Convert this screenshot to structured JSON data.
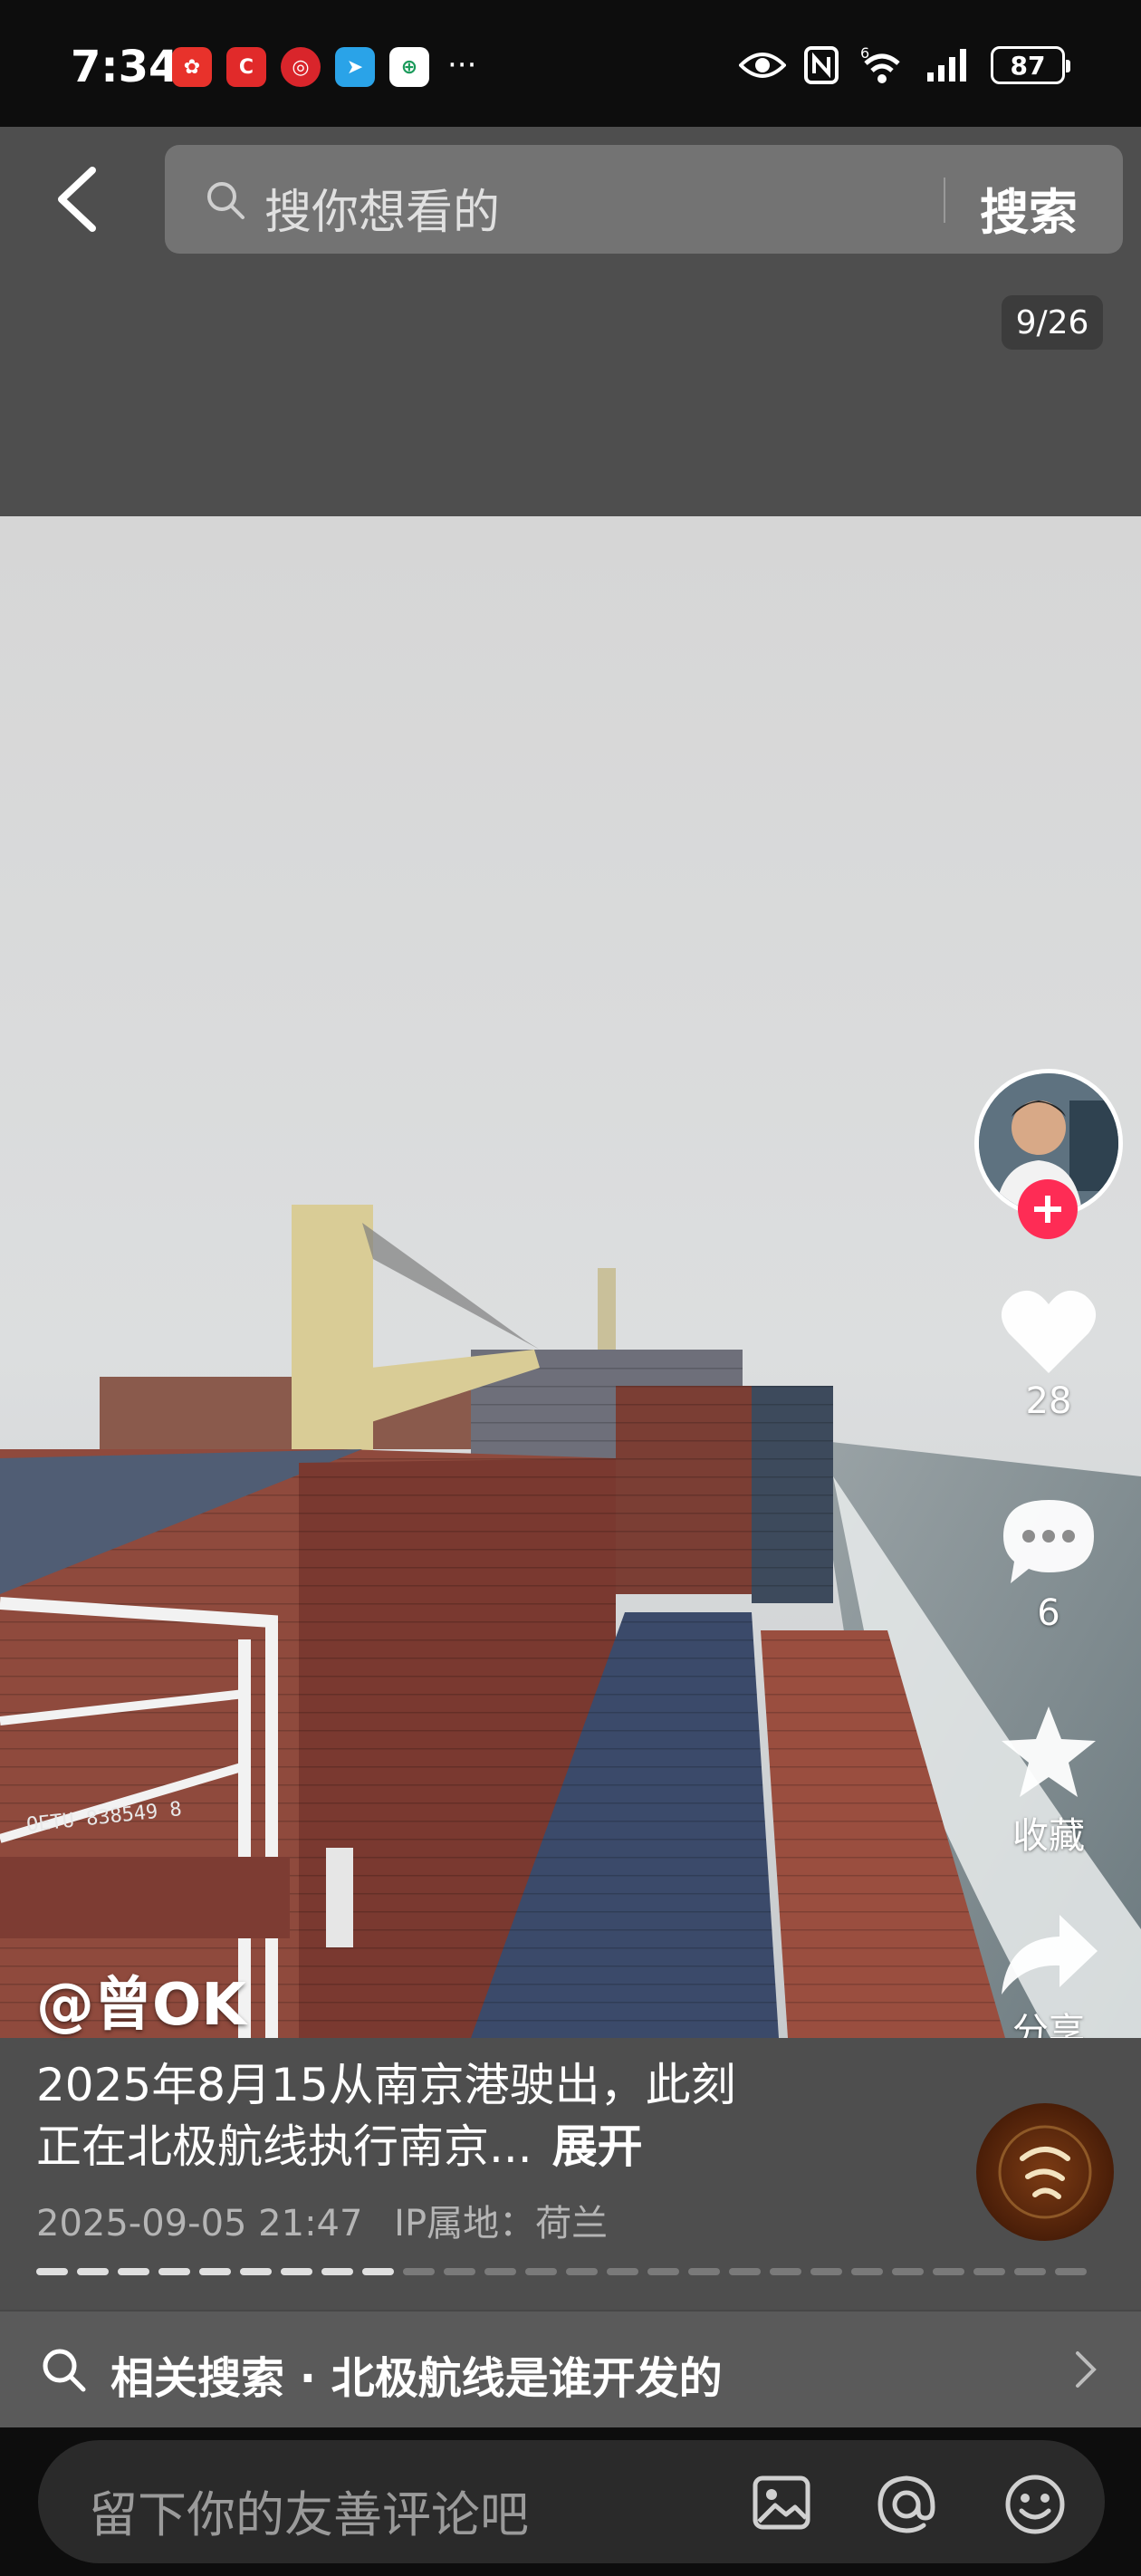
{
  "status_bar": {
    "time": "7:34",
    "battery": "87",
    "overflow": "···",
    "signal_label": "6"
  },
  "search": {
    "placeholder": "搜你想看的",
    "button_label": "搜索"
  },
  "page_counter": "9/26",
  "post": {
    "author": "@曾OK",
    "caption_line1": "2025年8月15从南京港驶出，此刻",
    "caption_line2": "正在北极航线执行南京...",
    "expand_label": "展开",
    "datetime": "2025-09-05 21:47",
    "ip_location": "IP属地：荷兰",
    "container_text": "OETU 838549 8"
  },
  "actions": {
    "likes": "28",
    "comments": "6",
    "favorite_label": "收藏",
    "share_label": "分享"
  },
  "progress": {
    "total": 26,
    "current": 9
  },
  "related_search": {
    "label": "相关搜索 · 北极航线是谁开发的"
  },
  "comment_bar": {
    "placeholder": "留下你的友善评论吧"
  },
  "colors": {
    "accent": "#fe2c55",
    "panel": "#4e4e4e",
    "bar": "#0d0d0d"
  }
}
